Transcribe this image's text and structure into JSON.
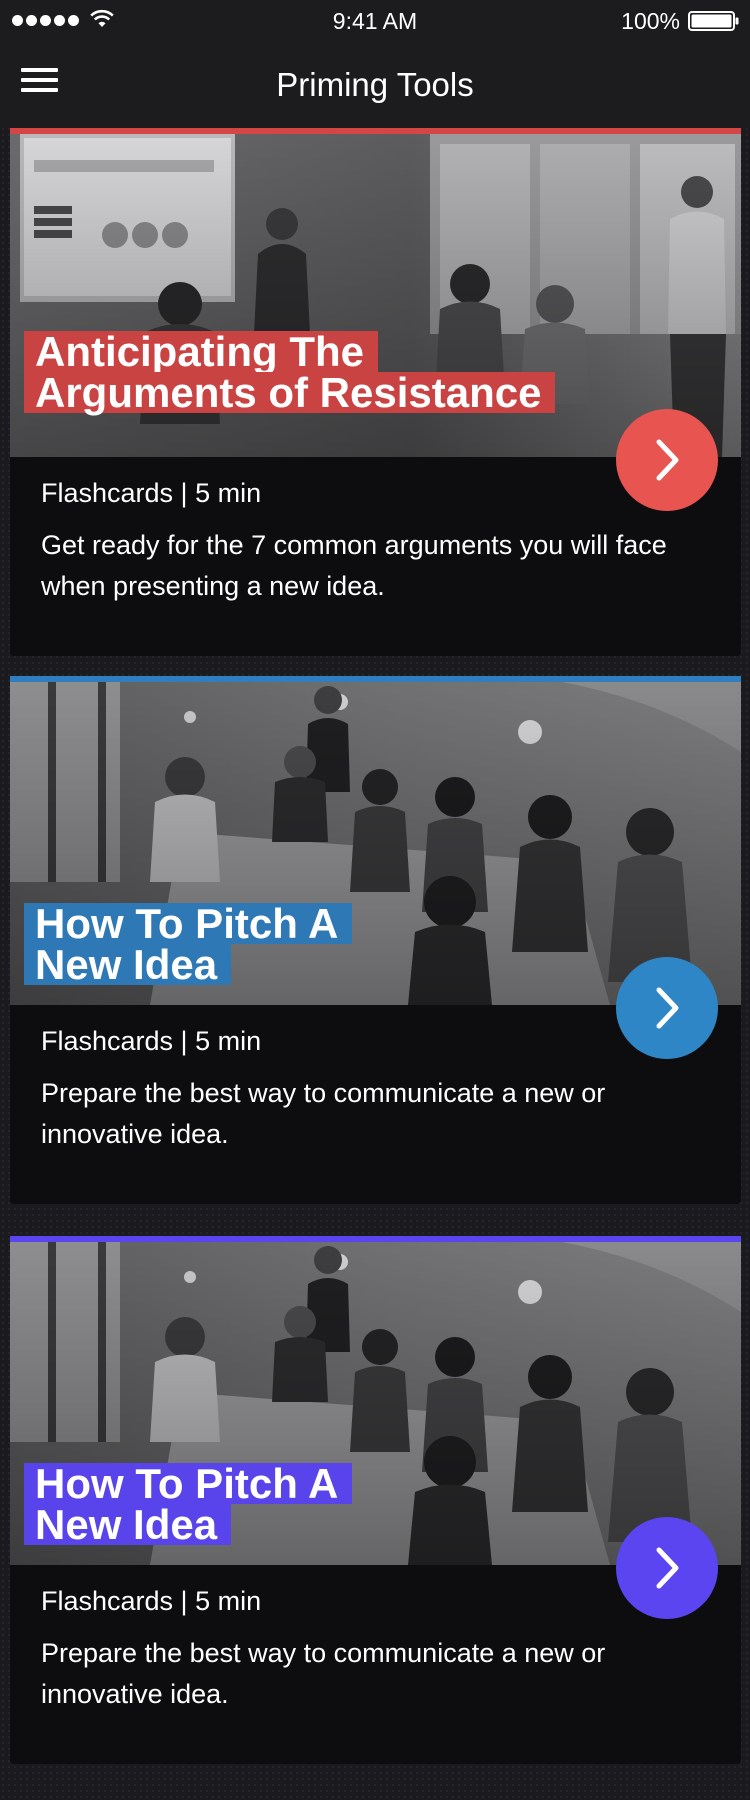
{
  "status_bar": {
    "time": "9:41 AM",
    "battery": "100%"
  },
  "nav": {
    "title": "Priming Tools"
  },
  "colors": {
    "red": "#e04747",
    "blue": "#2f7fc0",
    "purple": "#5a45f0"
  },
  "cards": [
    {
      "title_line1": "Anticipating The",
      "title_line2": "Arguments of Resistance",
      "meta": "Flashcards | 5 min",
      "description": "Get ready for the 7 common arguments you will face when presenting a new idea.",
      "accent": "#d64545"
    },
    {
      "title_line1": "How To Pitch A",
      "title_line2": "New Idea",
      "meta": "Flashcards | 5 min",
      "description": "Prepare the best way to communicate a new or innovative idea.",
      "accent": "#2f7fc0"
    },
    {
      "title_line1": "How To Pitch A",
      "title_line2": "New Idea",
      "meta": "Flashcards | 5 min",
      "description": "Prepare the best way to communicate a new or innovative idea.",
      "accent": "#5a45f0"
    }
  ]
}
